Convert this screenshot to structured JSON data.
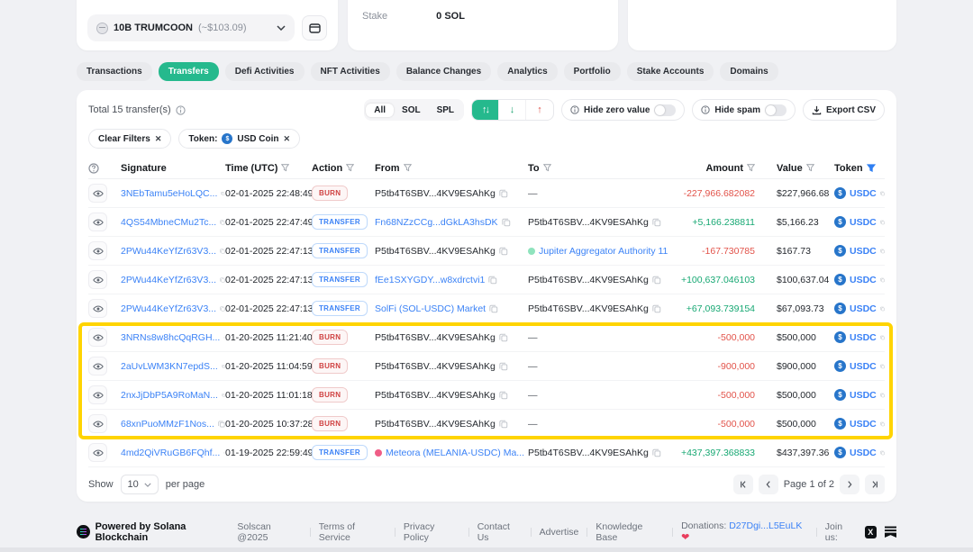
{
  "account": {
    "token_label": "10B TRUMCOON",
    "token_value": "(~$103.09)",
    "stake_label": "Stake",
    "stake_value": "0 SOL"
  },
  "tabs": [
    {
      "label": "Transactions",
      "active": false
    },
    {
      "label": "Transfers",
      "active": true
    },
    {
      "label": "Defi Activities",
      "active": false
    },
    {
      "label": "NFT Activities",
      "active": false
    },
    {
      "label": "Balance Changes",
      "active": false
    },
    {
      "label": "Analytics",
      "active": false
    },
    {
      "label": "Portfolio",
      "active": false
    },
    {
      "label": "Stake Accounts",
      "active": false
    },
    {
      "label": "Domains",
      "active": false
    }
  ],
  "toolbar": {
    "total": "Total 15 transfer(s)",
    "filter_all": "All",
    "filter_sol": "SOL",
    "filter_spl": "SPL",
    "hide_zero": "Hide zero value",
    "hide_spam": "Hide spam",
    "export": "Export CSV"
  },
  "filters": {
    "clear": "Clear Filters",
    "token_prefix": "Token:",
    "token_name": "USD Coin"
  },
  "table": {
    "headers": {
      "signature": "Signature",
      "time": "Time (UTC)",
      "action": "Action",
      "from": "From",
      "to": "To",
      "amount": "Amount",
      "value": "Value",
      "token": "Token"
    },
    "rows": [
      {
        "signature": "3NEbTamu5eHoLQC...",
        "time": "02-01-2025 22:48:49",
        "action": "BURN",
        "from": {
          "text": "P5tb4T6SBV...4KV9ESAhKg",
          "link": false
        },
        "to": {
          "text": "—",
          "dash": true
        },
        "amount": "-227,966.682082",
        "direction": "neg",
        "value": "$227,966.68",
        "token": "USDC",
        "highlight": false
      },
      {
        "signature": "4QS54MbneCMu2Tc...",
        "time": "02-01-2025 22:47:49",
        "action": "TRANSFER",
        "from": {
          "text": "Fn68NZzCCg...dGkLA3hsDK",
          "link": true
        },
        "to": {
          "text": "P5tb4T6SBV...4KV9ESAhKg",
          "link": false
        },
        "amount": "+5,166.238811",
        "direction": "pos",
        "value": "$5,166.23",
        "token": "USDC",
        "highlight": false
      },
      {
        "signature": "2PWu44KeYfZr63V3...",
        "time": "02-01-2025 22:47:13",
        "action": "TRANSFER",
        "from": {
          "text": "P5tb4T6SBV...4KV9ESAhKg",
          "link": false
        },
        "to": {
          "text": "Jupiter Aggregator Authority 11",
          "link": true,
          "dot": "#8fe3bd"
        },
        "amount": "-167.730785",
        "direction": "neg",
        "value": "$167.73",
        "token": "USDC",
        "highlight": false
      },
      {
        "signature": "2PWu44KeYfZr63V3...",
        "time": "02-01-2025 22:47:13",
        "action": "TRANSFER",
        "from": {
          "text": "fEe1SXYGDY...w8xdrctvi1",
          "link": true
        },
        "to": {
          "text": "P5tb4T6SBV...4KV9ESAhKg",
          "link": false
        },
        "amount": "+100,637.046103",
        "direction": "pos",
        "value": "$100,637.04",
        "token": "USDC",
        "highlight": false
      },
      {
        "signature": "2PWu44KeYfZr63V3...",
        "time": "02-01-2025 22:47:13",
        "action": "TRANSFER",
        "from": {
          "text": "SolFi (SOL-USDC) Market",
          "link": true
        },
        "to": {
          "text": "P5tb4T6SBV...4KV9ESAhKg",
          "link": false
        },
        "amount": "+67,093.739154",
        "direction": "pos",
        "value": "$67,093.73",
        "token": "USDC",
        "highlight": false
      },
      {
        "signature": "3NRNs8w8hcQqRGH...",
        "time": "01-20-2025 11:21:40",
        "action": "BURN",
        "from": {
          "text": "P5tb4T6SBV...4KV9ESAhKg",
          "link": false
        },
        "to": {
          "text": "—",
          "dash": true
        },
        "amount": "-500,000",
        "direction": "neg",
        "value": "$500,000",
        "token": "USDC",
        "highlight": true
      },
      {
        "signature": "2aUvLWM3KN7epdS...",
        "time": "01-20-2025 11:04:59",
        "action": "BURN",
        "from": {
          "text": "P5tb4T6SBV...4KV9ESAhKg",
          "link": false
        },
        "to": {
          "text": "—",
          "dash": true
        },
        "amount": "-900,000",
        "direction": "neg",
        "value": "$900,000",
        "token": "USDC",
        "highlight": true
      },
      {
        "signature": "2nxJjDbP5A9RoMaN...",
        "time": "01-20-2025 11:01:18",
        "action": "BURN",
        "from": {
          "text": "P5tb4T6SBV...4KV9ESAhKg",
          "link": false
        },
        "to": {
          "text": "—",
          "dash": true
        },
        "amount": "-500,000",
        "direction": "neg",
        "value": "$500,000",
        "token": "USDC",
        "highlight": true
      },
      {
        "signature": "68xnPuoMMzF1Nos...",
        "time": "01-20-2025 10:37:28",
        "action": "BURN",
        "from": {
          "text": "P5tb4T6SBV...4KV9ESAhKg",
          "link": false
        },
        "to": {
          "text": "—",
          "dash": true
        },
        "amount": "-500,000",
        "direction": "neg",
        "value": "$500,000",
        "token": "USDC",
        "highlight": true
      },
      {
        "signature": "4md2QiVRuGB6FQhf...",
        "time": "01-19-2025 22:59:49",
        "action": "TRANSFER",
        "from": {
          "text": "Meteora (MELANIA-USDC) Ma...",
          "link": true,
          "dot": "#ef5d86"
        },
        "to": {
          "text": "P5tb4T6SBV...4KV9ESAhKg",
          "link": false
        },
        "amount": "+437,397.368833",
        "direction": "pos",
        "value": "$437,397.36",
        "token": "USDC",
        "highlight": false
      }
    ]
  },
  "pagination": {
    "show_label": "Show",
    "page_size": "10",
    "per_page_label": "per page",
    "page_info": "Page 1 of 2"
  },
  "footer": {
    "brand": "Powered by Solana Blockchain",
    "links": [
      "Solscan @2025",
      "Terms of Service",
      "Privacy Policy",
      "Contact Us",
      "Advertise",
      "Knowledge Base"
    ],
    "donations_label": "Donations:",
    "donations_value": "D27Dgi...L5EuLK",
    "join_label": "Join us:"
  },
  "icons": {
    "close": "✕",
    "heart": "❤",
    "sort_both": "↑↓",
    "sort_down": "↓",
    "sort_up": "↑",
    "x_logo": "X",
    "usdc_symbol": "$"
  },
  "colors": {
    "accent_teal": "#25b98d",
    "link_blue": "#3b82f6",
    "negative_red": "#e2534a",
    "positive_green": "#17a873",
    "usdc_blue": "#2775CA",
    "highlight_yellow": "#ffd400"
  }
}
